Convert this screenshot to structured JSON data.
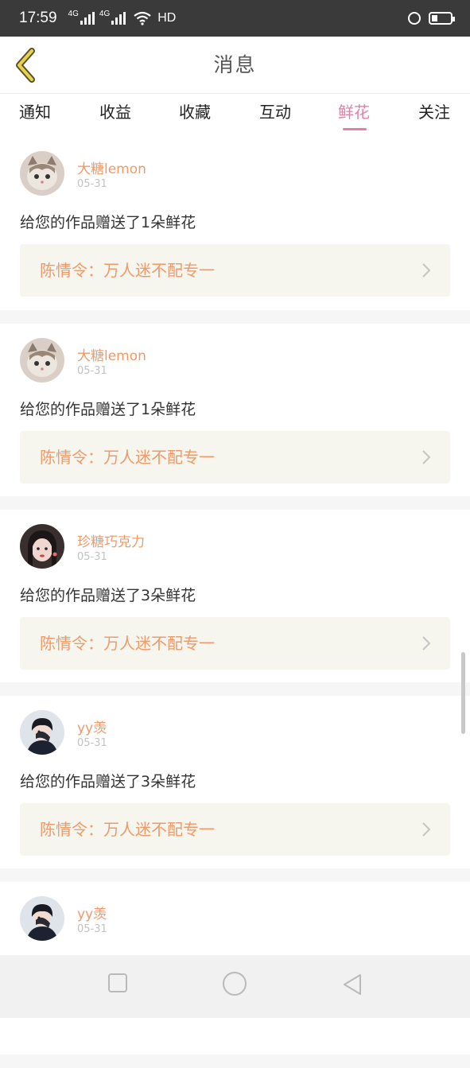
{
  "status_bar": {
    "time": "17:59",
    "network_1": "4G",
    "network_2": "4G",
    "hd": "HD"
  },
  "header": {
    "title": "消息"
  },
  "tabs": [
    {
      "label": "通知",
      "active": false
    },
    {
      "label": "收益",
      "active": false
    },
    {
      "label": "收藏",
      "active": false
    },
    {
      "label": "互动",
      "active": false
    },
    {
      "label": "鲜花",
      "active": true
    },
    {
      "label": "关注",
      "active": false
    }
  ],
  "messages": [
    {
      "username": "大糖lemon",
      "date": "05-31",
      "text": "给您的作品赠送了1朵鲜花",
      "work": "陈情令：万人迷不配专一",
      "avatar": "cat"
    },
    {
      "username": "大糖lemon",
      "date": "05-31",
      "text": "给您的作品赠送了1朵鲜花",
      "work": "陈情令：万人迷不配专一",
      "avatar": "cat"
    },
    {
      "username": "珍糖巧克力",
      "date": "05-31",
      "text": "给您的作品赠送了3朵鲜花",
      "work": "陈情令：万人迷不配专一",
      "avatar": "girl"
    },
    {
      "username": "yy羡",
      "date": "05-31",
      "text": "给您的作品赠送了3朵鲜花",
      "work": "陈情令：万人迷不配专一",
      "avatar": "boy"
    },
    {
      "username": "yy羡",
      "date": "05-31",
      "text": "",
      "work": "",
      "avatar": "boy"
    }
  ],
  "colors": {
    "accent": "#e57ea8",
    "username": "#ef9a6a",
    "back_arrow": "#e8d24a"
  }
}
